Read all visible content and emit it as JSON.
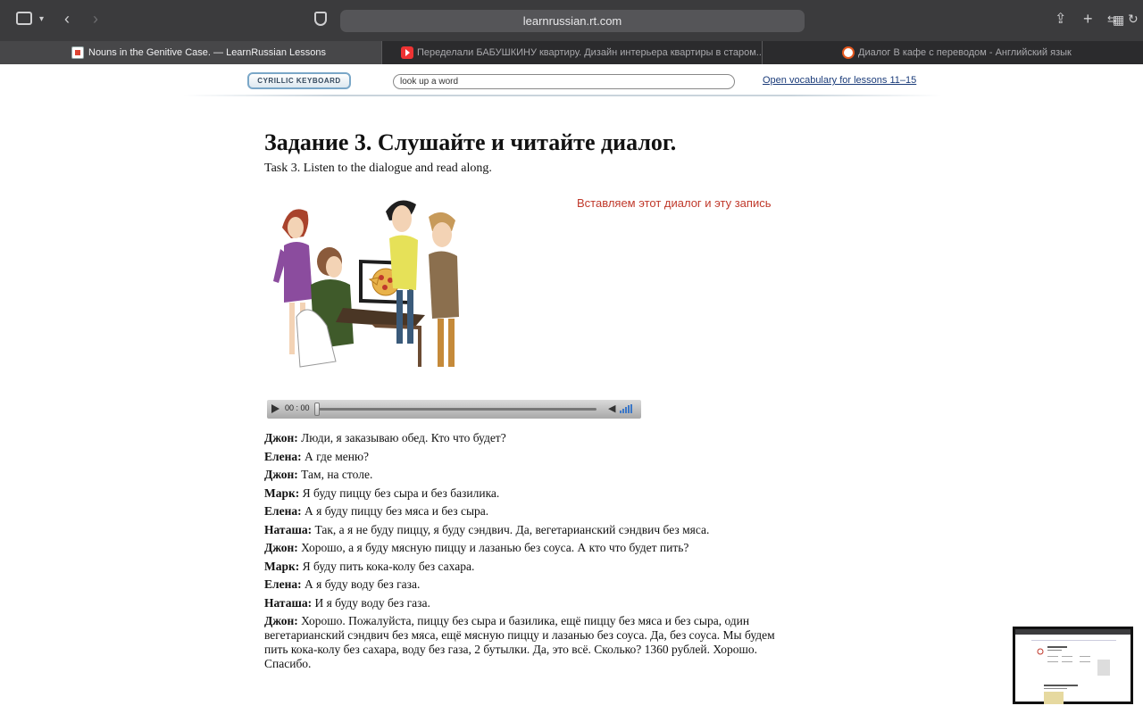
{
  "browser": {
    "url": "learnrussian.rt.com",
    "tabs": [
      {
        "title": "Nouns in the Genitive Case. — LearnRussian Lessons",
        "active": true
      },
      {
        "title": "Переделали БАБУШКИНУ квартиру. Дизайн интерьера квартиры в старом...",
        "active": false
      },
      {
        "title": "Диалог В кафе с переводом - Английский язык",
        "active": false
      }
    ]
  },
  "header": {
    "keyboard_button": "CYRILLIC KEYBOARD",
    "lookup_placeholder": "look up a word",
    "vocab_link": "Open vocabulary for lessons 11–15"
  },
  "task": {
    "title": "Задание 3. Слушайте и читайте диалог.",
    "subtitle": "Task 3. Listen to the dialogue and read along.",
    "note": "Вставляем этот диалог и эту запись"
  },
  "player": {
    "time": "00 : 00",
    "progress": 0
  },
  "dialogue": [
    {
      "speaker": "Джон:",
      "text": " Люди, я заказываю обед. Кто что будет?"
    },
    {
      "speaker": "Елена:",
      "text": " А где меню?"
    },
    {
      "speaker": "Джон:",
      "text": " Там, на столе."
    },
    {
      "speaker": "Марк:",
      "text": " Я буду пиццу без сыра и без базилика."
    },
    {
      "speaker": "Елена:",
      "text": " А я буду пиццу без мяса и без сыра."
    },
    {
      "speaker": "Наташа:",
      "text": " Так, а я не буду пиццу, я буду сэндвич. Да, вегетарианский сэндвич без мяса."
    },
    {
      "speaker": "Джон:",
      "text": " Хорошо, а я буду мясную пиццу и лазанью без соуса. А кто что будет пить?"
    },
    {
      "speaker": "Марк:",
      "text": " Я буду пить кока-колу без сахара."
    },
    {
      "speaker": "Елена:",
      "text": " А я буду воду без газа."
    },
    {
      "speaker": "Наташа:",
      "text": " И я буду воду без газа."
    },
    {
      "speaker": "Джон:",
      "text": " Хорошо. Пожалуйста, пиццу без сыра и базилика, ещё пиццу без мяса и без сыра, один вегетарианский сэндвич без мяса, ещё мясную пиццу и лазанью без соуса. Да, без соуса. Мы будем пить кока-колу без сахара, воду без газа, 2 бутылки. Да, это всё. Сколько? 1360 рублей. Хорошо. Спасибо."
    }
  ]
}
